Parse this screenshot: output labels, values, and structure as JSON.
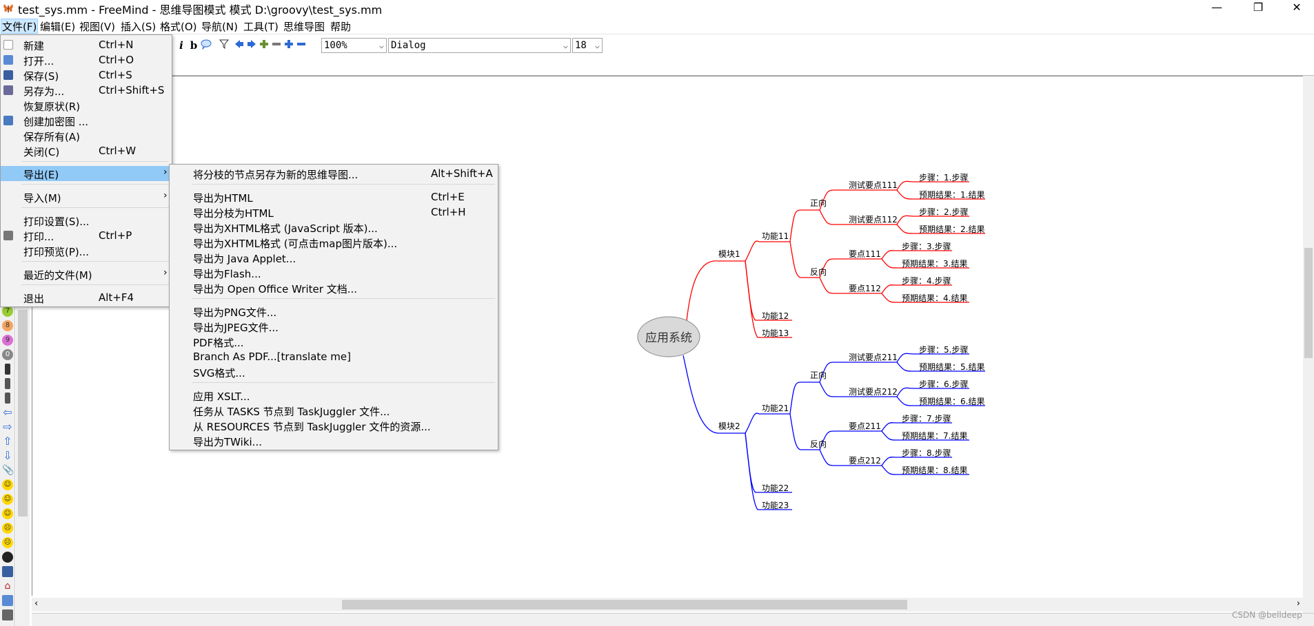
{
  "window": {
    "title": "test_sys.mm - FreeMind - 思维导图模式 模式 D:\\groovy\\test_sys.mm",
    "minimize": "—",
    "restore": "❐",
    "close": "✕"
  },
  "menubar": [
    "文件(F)",
    "编辑(E)",
    "视图(V)",
    "插入(S)",
    "格式(O)",
    "导航(N)",
    "工具(T)",
    "思维导图",
    "帮助"
  ],
  "toolbar": {
    "italic": "i",
    "bold": "b",
    "zoom": "100%",
    "font": "Dialog",
    "font_size": "18"
  },
  "file_menu": [
    {
      "label": "新建",
      "shortcut": "Ctrl+N",
      "icon": "new-file-icon"
    },
    {
      "label": "打开...",
      "shortcut": "Ctrl+O",
      "icon": "open-folder-icon"
    },
    {
      "label": "保存(S)",
      "shortcut": "Ctrl+S",
      "icon": "save-icon"
    },
    {
      "label": "另存为...",
      "shortcut": "Ctrl+Shift+S",
      "icon": "save-as-icon"
    },
    {
      "label": "恢复原状(R)",
      "shortcut": "",
      "icon": ""
    },
    {
      "label": "创建加密图 ...",
      "shortcut": "",
      "icon": "lock-icon"
    },
    {
      "label": "保存所有(A)",
      "shortcut": "",
      "icon": ""
    },
    {
      "label": "关闭(C)",
      "shortcut": "Ctrl+W",
      "icon": ""
    },
    {
      "label": "导出(E)",
      "shortcut": "",
      "icon": "",
      "submenu": true,
      "highlighted": true
    },
    {
      "label": "导入(M)",
      "shortcut": "",
      "icon": "",
      "submenu": true
    },
    {
      "label": "打印设置(S)...",
      "shortcut": "",
      "icon": ""
    },
    {
      "label": "打印...",
      "shortcut": "Ctrl+P",
      "icon": "printer-icon"
    },
    {
      "label": "打印预览(P)...",
      "shortcut": "",
      "icon": ""
    },
    {
      "label": "最近的文件(M)",
      "shortcut": "",
      "icon": "",
      "submenu": true
    },
    {
      "label": "退出",
      "shortcut": "Alt+F4",
      "icon": ""
    }
  ],
  "export_menu": [
    {
      "label": "将分枝的节点另存为新的思维导图...",
      "shortcut": "Alt+Shift+A"
    },
    {
      "label": "导出为HTML",
      "shortcut": "Ctrl+E"
    },
    {
      "label": "导出分枝为HTML",
      "shortcut": "Ctrl+H"
    },
    {
      "label": "导出为XHTML格式 (JavaScript 版本)...",
      "shortcut": ""
    },
    {
      "label": "导出为XHTML格式 (可点击map图片版本)...",
      "shortcut": ""
    },
    {
      "label": "导出为 Java Applet...",
      "shortcut": ""
    },
    {
      "label": "导出为Flash...",
      "shortcut": ""
    },
    {
      "label": "导出为 Open Office Writer 文档...",
      "shortcut": ""
    },
    {
      "label": "导出为PNG文件...",
      "shortcut": ""
    },
    {
      "label": "导出为JPEG文件...",
      "shortcut": ""
    },
    {
      "label": "PDF格式...",
      "shortcut": ""
    },
    {
      "label": "Branch As PDF...[translate me]",
      "shortcut": ""
    },
    {
      "label": "SVG格式...",
      "shortcut": ""
    },
    {
      "label": "应用 XSLT...",
      "shortcut": ""
    },
    {
      "label": "任务从 TASKS 节点到 TaskJuggler 文件...",
      "shortcut": ""
    },
    {
      "label": "从 RESOURCES 节点到 TaskJuggler 文件的资源...",
      "shortcut": ""
    },
    {
      "label": "导出为TWiki...",
      "shortcut": ""
    }
  ],
  "mindmap": {
    "root": "应用系统",
    "module1": {
      "label": "模块1",
      "f11": "功能11",
      "f12": "功能12",
      "f13": "功能13",
      "pos": "正向",
      "neg": "反向",
      "t111": "测试要点111",
      "t112": "测试要点112",
      "p111": "要点111",
      "p112": "要点112",
      "leaves": [
        "步骤：1.步骤",
        "预期结果：1.结果",
        "步骤：2.步骤",
        "预期结果：2.结果",
        "步骤：3.步骤",
        "预期结果：3.结果",
        "步骤：4.步骤",
        "预期结果：4.结果"
      ]
    },
    "module2": {
      "label": "模块2",
      "f21": "功能21",
      "f22": "功能22",
      "f23": "功能23",
      "pos": "正向",
      "neg": "反向",
      "t211": "测试要点211",
      "t212": "测试要点212",
      "p211": "要点211",
      "p212": "要点212",
      "leaves": [
        "步骤：5.步骤",
        "预期结果：5.结果",
        "步骤：6.步骤",
        "预期结果：6.结果",
        "步骤：7.步骤",
        "预期结果：7.结果",
        "步骤：8.步骤",
        "预期结果：8.结果"
      ]
    },
    "colors": {
      "module1": "#ff0000",
      "module2": "#0000ff",
      "root_fill": "#d9d9d9"
    }
  },
  "watermark": "CSDN @belldeep"
}
